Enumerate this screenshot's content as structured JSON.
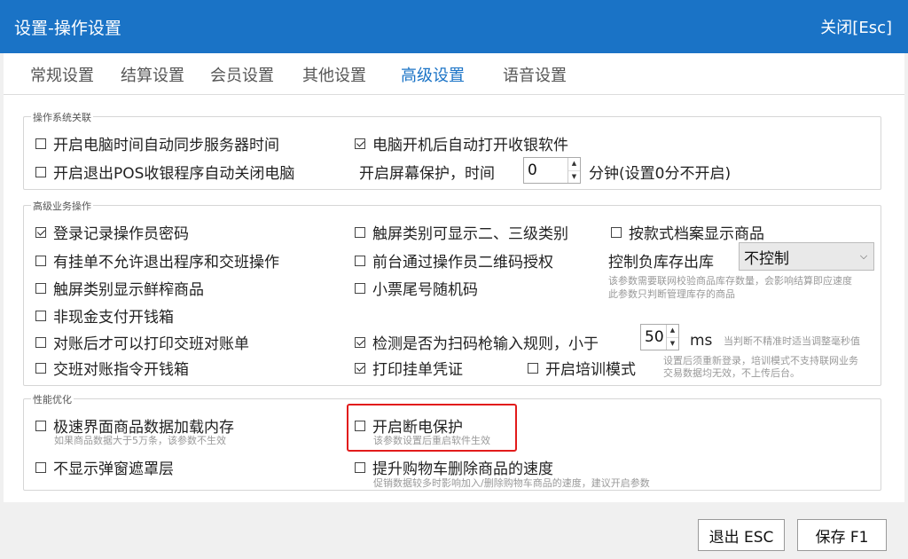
{
  "window": {
    "title": "设置-操作设置",
    "close_label": "关闭[Esc]"
  },
  "tabs": [
    "常规设置",
    "结算设置",
    "会员设置",
    "其他设置",
    "高级设置",
    "语音设置"
  ],
  "active_tab": "高级设置",
  "groups": {
    "os": {
      "legend": "操作系统关联",
      "sync_time": {
        "label": "开启电脑时间自动同步服务器时间",
        "checked": false
      },
      "auto_start": {
        "label": "电脑开机后自动打开收银软件",
        "checked": true
      },
      "auto_shutdown": {
        "label": "开启退出POS收银程序自动关闭电脑",
        "checked": false
      },
      "screensaver": {
        "label": "开启屏幕保护，时间",
        "value": "0",
        "suffix": "分钟(设置0分不开启)"
      }
    },
    "advanced": {
      "legend": "高级业务操作",
      "record_password": {
        "label": "登录记录操作员密码",
        "checked": true
      },
      "touch_subcategory": {
        "label": "触屏类别可显示二、三级类别",
        "checked": false
      },
      "style_display": {
        "label": "按款式档案显示商品",
        "checked": false
      },
      "no_exit_pending": {
        "label": "有挂单不允许退出程序和交班操作",
        "checked": false
      },
      "qr_auth": {
        "label": "前台通过操作员二维码授权",
        "checked": false
      },
      "negative_stock": {
        "label": "控制负库存出库",
        "value": "不控制",
        "hint_1": "该参数需要联网校验商品库存数量，会影响结算即应速度",
        "hint_2": "此参数只判断管理库存的商品"
      },
      "touch_fresh": {
        "label": "触屏类别显示鲜榨商品",
        "checked": false
      },
      "receipt_random": {
        "label": "小票尾号随机码",
        "checked": false
      },
      "non_cash_drawer": {
        "label": "非现金支付开钱箱",
        "checked": false
      },
      "print_after_reconcile": {
        "label": "对账后才可以打印交班对账单",
        "checked": false
      },
      "scanner_rule": {
        "label": "检测是否为扫码枪输入规则，小于",
        "checked": true,
        "value": "50",
        "unit": "ms",
        "hint": "当判断不精准时适当调整毫秒值"
      },
      "handover_drawer": {
        "label": "交班对账指令开钱箱",
        "checked": false
      },
      "print_pending": {
        "label": "打印挂单凭证",
        "checked": true
      },
      "training_mode": {
        "label": "开启培训模式",
        "checked": false,
        "hint_1": "设置后须重新登录，培训模式不支持联网业务",
        "hint_2": "交易数据均无效，不上传后台。"
      }
    },
    "performance": {
      "legend": "性能优化",
      "fast_load": {
        "label": "极速界面商品数据加载内存",
        "checked": false,
        "hint": "如果商品数据大于5万条，该参数不生效"
      },
      "power_protect": {
        "label": "开启断电保护",
        "checked": false,
        "hint": "该参数设置后重启软件生效"
      },
      "no_mask": {
        "label": "不显示弹窗遮罩层",
        "checked": false
      },
      "fast_delete": {
        "label": "提升购物车删除商品的速度",
        "checked": false,
        "hint": "促销数据较多时影响加入/删除购物车商品的速度，建议开启参数"
      }
    }
  },
  "buttons": {
    "exit": "退出 ESC",
    "save": "保存 F1"
  }
}
